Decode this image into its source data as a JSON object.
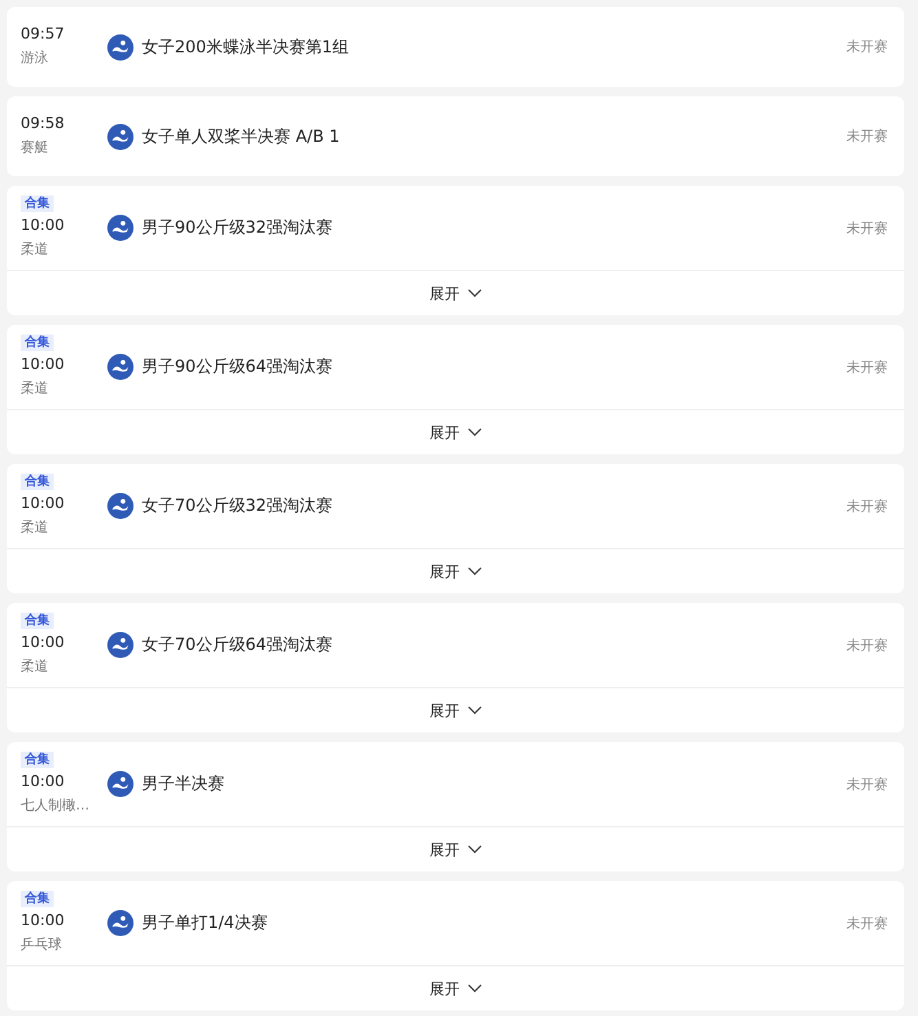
{
  "events": [
    {
      "time": "09:57",
      "sport": "游泳",
      "title": "女子200米蝶泳半决赛第1组",
      "status": "未开赛"
    },
    {
      "time": "09:58",
      "sport": "赛艇",
      "title": "女子单人双桨半决赛 A/B 1",
      "status": "未开赛"
    },
    {
      "tag": "合集",
      "time": "10:00",
      "sport": "柔道",
      "title": "男子90公斤级32强淘汰赛",
      "status": "未开赛",
      "expand": "展开"
    },
    {
      "tag": "合集",
      "time": "10:00",
      "sport": "柔道",
      "title": "男子90公斤级64强淘汰赛",
      "status": "未开赛",
      "expand": "展开"
    },
    {
      "tag": "合集",
      "time": "10:00",
      "sport": "柔道",
      "title": "女子70公斤级32强淘汰赛",
      "status": "未开赛",
      "expand": "展开"
    },
    {
      "tag": "合集",
      "time": "10:00",
      "sport": "柔道",
      "title": "女子70公斤级64强淘汰赛",
      "status": "未开赛",
      "expand": "展开"
    },
    {
      "tag": "合集",
      "time": "10:00",
      "sport": "七人制橄…",
      "title": "男子半决赛",
      "status": "未开赛",
      "expand": "展开"
    },
    {
      "tag": "合集",
      "time": "10:00",
      "sport": "乒乓球",
      "title": "男子单打1/4决赛",
      "status": "未开赛",
      "expand": "展开"
    }
  ]
}
